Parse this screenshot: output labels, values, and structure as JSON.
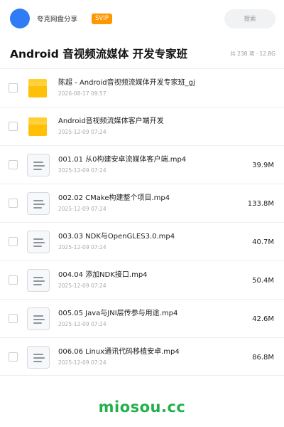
{
  "header": {
    "brand": "夸克网盘分享",
    "badge": "SVIP",
    "search_label": "搜索"
  },
  "folder": {
    "title": "Android 音视频流媒体 开发专家班",
    "meta": "共 238 项 · 12.8G"
  },
  "items": [
    {
      "type": "folder",
      "name": "陈超 - Android音视频流媒体开发专家班_gj",
      "date": "2026-08-17 09:57",
      "size": ""
    },
    {
      "type": "folder",
      "name": "Android音视频流媒体客户端开发",
      "date": "2025-12-09 07:24",
      "size": ""
    },
    {
      "type": "file",
      "name": "001.01 从0构建安卓流媒体客户端.mp4",
      "date": "2025-12-09 07:24",
      "size": "39.9M"
    },
    {
      "type": "file",
      "name": "002.02 CMake构建整个项目.mp4",
      "date": "2025-12-09 07:24",
      "size": "133.8M"
    },
    {
      "type": "file",
      "name": "003.03 NDK与OpenGLES3.0.mp4",
      "date": "2025-12-09 07:24",
      "size": "40.7M"
    },
    {
      "type": "file",
      "name": "004.04 添加NDK接口.mp4",
      "date": "2025-12-09 07:24",
      "size": "50.4M"
    },
    {
      "type": "file",
      "name": "005.05 Java与JNI层传参与用途.mp4",
      "date": "2025-12-09 07:24",
      "size": "42.6M"
    },
    {
      "type": "file",
      "name": "006.06 Linux通讯代码移植安卓.mp4",
      "date": "2025-12-09 07:24",
      "size": "86.8M"
    }
  ],
  "footer": {
    "watermark": "miosou.cc"
  },
  "colors": {
    "accent": "#2f7cf6",
    "badge": "#ff9800",
    "folder": "#ffc107",
    "watermark": "#22b04b"
  },
  "icons": {
    "folder": "folder-icon",
    "file": "video-file-icon"
  }
}
